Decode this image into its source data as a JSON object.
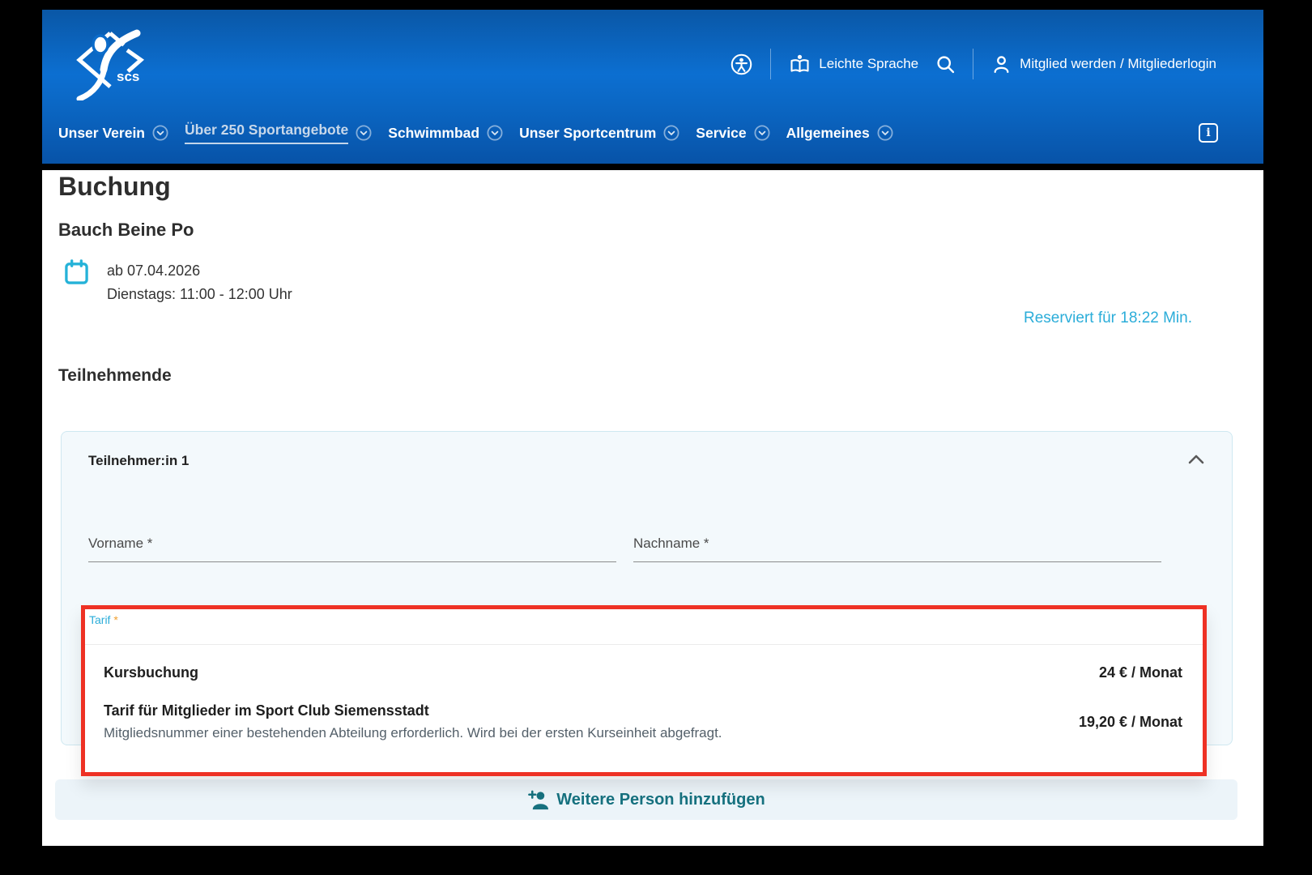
{
  "header": {
    "logo_text": "scs",
    "utility": {
      "leichte_sprache_label": "Leichte Sprache",
      "login_label": "Mitglied werden / Mitgliederlogin",
      "info_glyph": "i"
    },
    "nav": [
      {
        "label": "Unser Verein"
      },
      {
        "label": "Über 250 Sportangebote"
      },
      {
        "label": "Schwimmbad"
      },
      {
        "label": "Unser Sportcentrum"
      },
      {
        "label": "Service"
      },
      {
        "label": "Allgemeines"
      }
    ]
  },
  "page": {
    "title": "Buchung",
    "course_name": "Bauch Beine Po",
    "date_line1": "ab 07.04.2026",
    "date_line2": "Dienstags: 11:00 - 12:00 Uhr",
    "reservation_notice": "Reserviert für 18:22 Min.",
    "participants_heading": "Teilnehmende"
  },
  "participant_card": {
    "title": "Teilnehmer:in 1",
    "vorname_placeholder": "Vorname *",
    "nachname_placeholder": "Nachname *"
  },
  "tarif_dropdown": {
    "label": "Tarif",
    "required_mark": "*",
    "options": [
      {
        "name": "Kursbuchung",
        "description": "",
        "price": "24 € / Monat"
      },
      {
        "name": "Tarif für Mitglieder im Sport Club Siemensstadt",
        "description": "Mitgliedsnummer einer bestehenden Abteilung erforderlich. Wird bei der ersten Kurseinheit abgefragt.",
        "price": "19,20 € / Monat"
      }
    ]
  },
  "actions": {
    "add_person_label": "Weitere Person hinzufügen"
  },
  "icons": {
    "accessibility-icon": "person-in-circle",
    "easy-language-icon": "open-book-with-head",
    "search-icon": "magnifier",
    "user-icon": "person-outline",
    "info-icon": "i-in-rounded-square",
    "chevron-down-icon": "chevron-in-circle",
    "chevron-up-icon": "chevron-up",
    "calendar-icon": "calendar-outline",
    "add-person-icon": "person-plus"
  },
  "colors": {
    "header_blue": "#0c6fd1",
    "accent_cyan": "#2badd9",
    "calendar_cyan": "#25b2d8",
    "teal": "#16717f",
    "annotation_red": "#ee3124",
    "required_orange": "#f0a030",
    "card_bg": "#f3f9fc"
  }
}
